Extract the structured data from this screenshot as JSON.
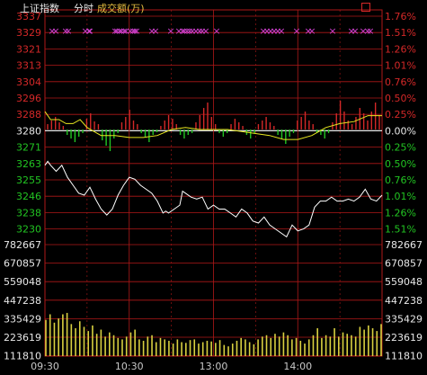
{
  "header": {
    "index_name": "上证指数",
    "mode": "分时",
    "volume_label": "成交额(万)"
  },
  "colors": {
    "up": "#d42828",
    "down": "#22c422",
    "neutral": "#e8e8e8",
    "grid": "#b01818",
    "price_line": "#ffffff",
    "avg_line": "#e8e820",
    "volume_bar": "#d8d040",
    "markers": "#d040d0",
    "axis_time": "#c8c8c8"
  },
  "chart_data": [
    {
      "type": "line",
      "name": "price",
      "y_left_labels": [
        "3337",
        "3329",
        "3321",
        "3313",
        "3304",
        "3296",
        "3288",
        "3280",
        "3271",
        "3263",
        "3255",
        "3246",
        "3238",
        "3230"
      ],
      "y_right_labels": [
        "1.76%",
        "1.51%",
        "1.26%",
        "1.01%",
        "0.76%",
        "0.50%",
        "0.25%",
        "0.00%",
        "0.25%",
        "0.50%",
        "0.76%",
        "1.01%",
        "1.26%",
        "1.51%"
      ],
      "ylim": [
        3225.5,
        3341.5
      ],
      "prev_close": 3280,
      "x_ticks": [
        "09:30",
        "10:30",
        "13:00",
        "14:00"
      ],
      "price_points": [
        [
          0,
          3262
        ],
        [
          2,
          3264
        ],
        [
          4,
          3262
        ],
        [
          8,
          3259
        ],
        [
          12,
          3262
        ],
        [
          16,
          3256
        ],
        [
          20,
          3252
        ],
        [
          24,
          3248
        ],
        [
          28,
          3247
        ],
        [
          32,
          3251
        ],
        [
          36,
          3245
        ],
        [
          40,
          3240
        ],
        [
          44,
          3237
        ],
        [
          48,
          3240
        ],
        [
          52,
          3247
        ],
        [
          56,
          3252
        ],
        [
          60,
          3256
        ],
        [
          64,
          3255
        ],
        [
          68,
          3252
        ],
        [
          72,
          3250
        ],
        [
          76,
          3248
        ],
        [
          80,
          3244
        ],
        [
          84,
          3238
        ],
        [
          86,
          3239
        ],
        [
          88,
          3238
        ],
        [
          92,
          3240
        ],
        [
          96,
          3242
        ],
        [
          98,
          3249
        ],
        [
          100,
          3248
        ],
        [
          104,
          3246
        ],
        [
          108,
          3245
        ],
        [
          112,
          3246
        ],
        [
          116,
          3240
        ],
        [
          120,
          3242
        ],
        [
          124,
          3240
        ],
        [
          128,
          3240
        ],
        [
          132,
          3238
        ],
        [
          136,
          3236
        ],
        [
          140,
          3240
        ],
        [
          144,
          3238
        ],
        [
          148,
          3234
        ],
        [
          152,
          3233
        ],
        [
          156,
          3236
        ],
        [
          160,
          3232
        ],
        [
          164,
          3230
        ],
        [
          168,
          3228
        ],
        [
          172,
          3226
        ],
        [
          176,
          3232
        ],
        [
          180,
          3229
        ],
        [
          184,
          3230
        ],
        [
          188,
          3232
        ],
        [
          192,
          3241
        ],
        [
          196,
          3244
        ],
        [
          200,
          3244
        ],
        [
          204,
          3246
        ],
        [
          208,
          3244
        ],
        [
          212,
          3244
        ],
        [
          216,
          3245
        ],
        [
          220,
          3244
        ],
        [
          224,
          3246
        ],
        [
          228,
          3250
        ],
        [
          232,
          3245
        ],
        [
          236,
          3244
        ],
        [
          240,
          3247
        ]
      ],
      "avg_points": [
        [
          0,
          3289
        ],
        [
          4,
          3285
        ],
        [
          10,
          3285
        ],
        [
          15,
          3283
        ],
        [
          20,
          3283
        ],
        [
          25,
          3285
        ],
        [
          30,
          3281
        ],
        [
          35,
          3279
        ],
        [
          40,
          3277
        ],
        [
          50,
          3277
        ],
        [
          60,
          3276
        ],
        [
          70,
          3276
        ],
        [
          80,
          3277
        ],
        [
          90,
          3280
        ],
        [
          100,
          3281
        ],
        [
          110,
          3280
        ],
        [
          120,
          3280
        ],
        [
          130,
          3280
        ],
        [
          140,
          3279
        ],
        [
          150,
          3278
        ],
        [
          160,
          3277
        ],
        [
          170,
          3275
        ],
        [
          180,
          3275
        ],
        [
          190,
          3277
        ],
        [
          200,
          3281
        ],
        [
          210,
          3283
        ],
        [
          220,
          3284
        ],
        [
          230,
          3287
        ],
        [
          240,
          3287
        ]
      ]
    },
    {
      "type": "bar",
      "name": "volume",
      "y_labels": [
        "782667",
        "670857",
        "559048",
        "447238",
        "335429",
        "223619",
        "111810"
      ],
      "ylim": [
        0,
        800000
      ],
      "levels": [
        260000,
        300000,
        240000,
        270000,
        300000,
        310000,
        230000,
        200000,
        250000,
        210000,
        180000,
        220000,
        160000,
        190000,
        140000,
        170000,
        150000,
        130000,
        120000,
        140000,
        170000,
        190000,
        120000,
        110000,
        140000,
        150000,
        100000,
        130000,
        120000,
        110000,
        90000,
        120000,
        100000,
        95000,
        115000,
        120000,
        90000,
        100000,
        110000,
        105000,
        95000,
        115000,
        80000,
        70000,
        90000,
        110000,
        130000,
        120000,
        100000,
        85000,
        120000,
        140000,
        150000,
        130000,
        160000,
        140000,
        170000,
        150000,
        120000,
        130000,
        110000,
        90000,
        120000,
        150000,
        200000,
        130000,
        150000,
        140000,
        200000,
        140000,
        170000,
        160000,
        150000,
        140000,
        210000,
        190000,
        220000,
        200000,
        180000,
        230000
      ]
    }
  ]
}
